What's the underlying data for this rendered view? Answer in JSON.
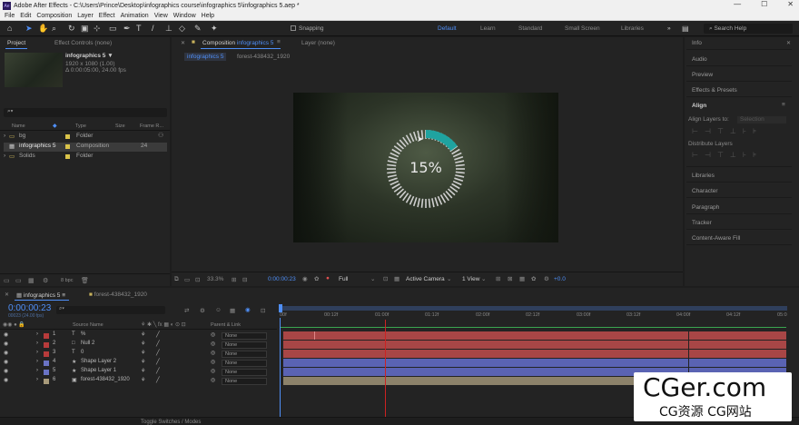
{
  "window": {
    "title": "Adobe After Effects - C:\\Users\\Prince\\Desktop\\infographics course\\infographics 5\\infographics 5.aep *",
    "app_badge": "Ae",
    "minimize": "—",
    "maximize": "☐",
    "close": "✕"
  },
  "menu": [
    "File",
    "Edit",
    "Composition",
    "Layer",
    "Effect",
    "Animation",
    "View",
    "Window",
    "Help"
  ],
  "toolbar": {
    "snapping": "Snapping",
    "workspaces": [
      "Default",
      "Learn",
      "Standard",
      "Small Screen",
      "Libraries"
    ],
    "active_workspace": "Default",
    "search_placeholder": "Search Help",
    "more": "»"
  },
  "project": {
    "tab_project": "Project",
    "tab_effect_controls": "Effect Controls (none)",
    "selected_name": "infographics 5 ▼",
    "selected_dims": "1920 x 1080 (1.00)",
    "selected_duration": "Δ 0:00:05:00, 24.00 fps",
    "search_placeholder": "⌕▾",
    "columns": {
      "name": "Name",
      "type": "Type",
      "size": "Size",
      "frame_rate": "Frame R..."
    },
    "items": [
      {
        "name": "bg",
        "type": "Folder",
        "rate": ""
      },
      {
        "name": "infographics 5",
        "type": "Composition",
        "rate": "24"
      },
      {
        "name": "Solids",
        "type": "Folder",
        "rate": ""
      }
    ],
    "bpc": "8 bpc"
  },
  "composition": {
    "tab_comp_prefix": "Composition",
    "tab_comp_name": "infographics 5",
    "tab_layer": "Layer (none)",
    "crumbs": [
      "infographics 5",
      "forest-438432_1920"
    ],
    "percent": "15%",
    "progress": 0.15,
    "zoom": "33.3%",
    "timecode": "0:00:00:23",
    "resolution": "Full",
    "camera": "Active Camera",
    "views": "1 View",
    "exposure": "+0.0"
  },
  "right_panel": {
    "items": [
      "Info",
      "Audio",
      "Preview",
      "Effects & Presets"
    ],
    "align_title": "Align",
    "align_layers_to": "Align Layers to:",
    "align_target": "Selection",
    "distribute": "Distribute Layers",
    "items2": [
      "Libraries",
      "Character",
      "Paragraph",
      "Tracker",
      "Content-Aware Fill"
    ]
  },
  "timeline": {
    "tab_comp": "infographics 5",
    "tab_footage": "forest-438432_1920",
    "timecode": "0:00:00:23",
    "timecode_sub": "00023 (24.00 fps)",
    "search_placeholder": "⌕▾",
    "col_source": "Source Name",
    "col_parent": "Parent & Link",
    "ruler": [
      "00f",
      "00:12f",
      "01:00f",
      "01:12f",
      "02:00f",
      "02:12f",
      "03:00f",
      "03:12f",
      "04:00f",
      "04:12f",
      "05:0"
    ],
    "layers": [
      {
        "num": "1",
        "glyph": "T",
        "name": "%",
        "color": "#b83b3b",
        "parent": "None"
      },
      {
        "num": "2",
        "glyph": "□",
        "name": "Null 2",
        "color": "#b83b3b",
        "parent": "None"
      },
      {
        "num": "3",
        "glyph": "T",
        "name": "0",
        "color": "#b83b3b",
        "parent": "None"
      },
      {
        "num": "4",
        "glyph": "★",
        "name": "Shape Layer 2",
        "color": "#6a73c4",
        "parent": "None"
      },
      {
        "num": "5",
        "glyph": "★",
        "name": "Shape Layer 1",
        "color": "#6a73c4",
        "parent": "None"
      },
      {
        "num": "6",
        "glyph": "▣",
        "name": "forest-438432_1920",
        "color": "#a89a7a",
        "parent": "None"
      }
    ],
    "toggle_label": "Toggle Switches / Modes"
  },
  "watermark": {
    "line1": "CGer.com",
    "line2": "CG资源 CG网站"
  },
  "colors": {
    "accent": "#4f8ff7",
    "progress_arc": "#1fa3a0",
    "layer_red": "#b83b3b",
    "layer_blue": "#6a73c4",
    "layer_tan": "#a89a7a"
  }
}
